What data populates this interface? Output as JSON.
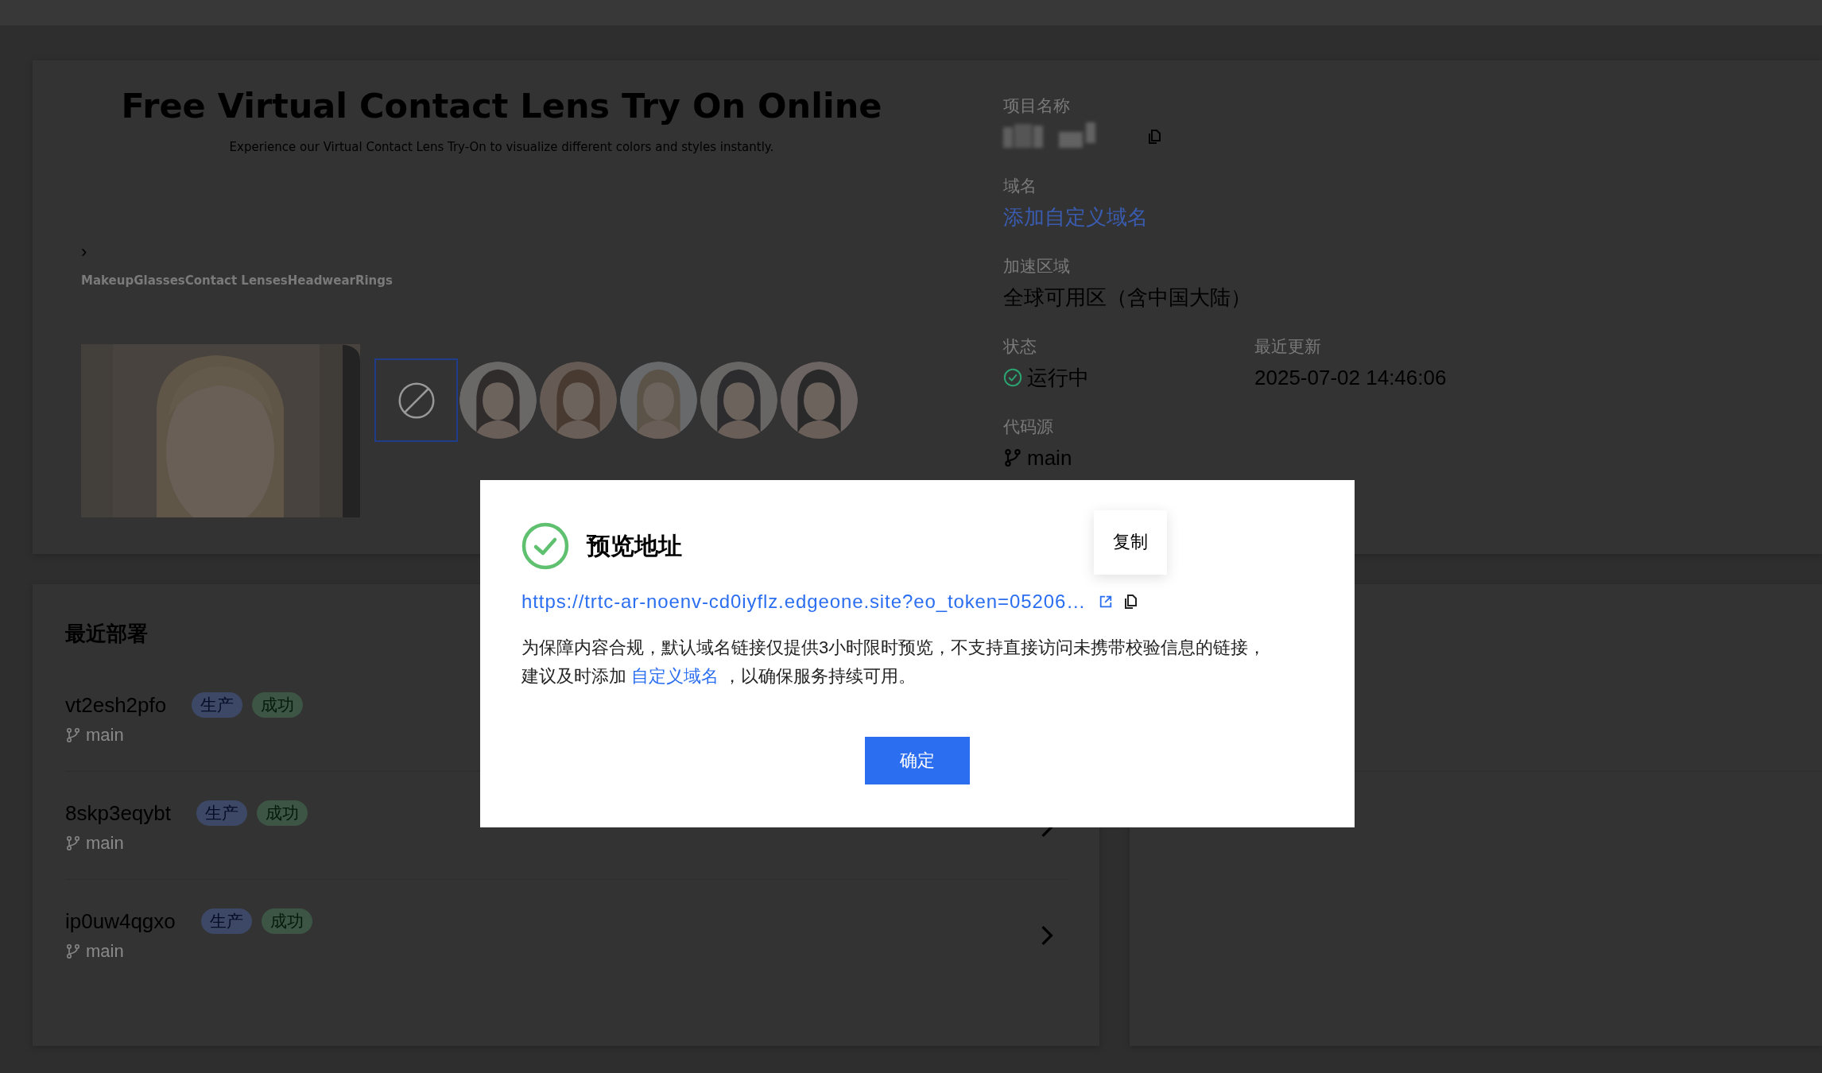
{
  "preview": {
    "title": "Free Virtual Contact Lens Try On Online",
    "subtitle": "Experience our Virtual Contact Lens Try-On to visualize different colors and styles instantly.",
    "chevron": "›",
    "tabs": [
      {
        "label": "Makeup"
      },
      {
        "label": "Glasses"
      },
      {
        "label": "Contact Lenses"
      },
      {
        "label": "Headwear"
      },
      {
        "label": "Rings"
      }
    ],
    "thumbnails": [
      {
        "kind": "none",
        "selected": true
      },
      {
        "kind": "avatar",
        "selected": false
      },
      {
        "kind": "avatar",
        "selected": false
      },
      {
        "kind": "avatar",
        "selected": false
      },
      {
        "kind": "avatar",
        "selected": false
      },
      {
        "kind": "avatar",
        "selected": false
      }
    ]
  },
  "info": [
    {
      "kind": "redacted",
      "label": "项目名称"
    },
    {
      "kind": "link",
      "label": "域名",
      "value": "添加自定义域名"
    },
    {
      "kind": "text",
      "label": "加速区域",
      "value": "全球可用区（含中国大陆）"
    },
    {
      "kind": "pair",
      "items": [
        {
          "kind": "status",
          "label": "状态",
          "value": "运行中"
        },
        {
          "kind": "text",
          "label": "最近更新",
          "value": "2025-07-02 14:46:06"
        }
      ]
    },
    {
      "kind": "branch",
      "label": "代码源",
      "value": "main"
    }
  ],
  "deployments": {
    "title": "最近部署",
    "items": [
      {
        "name": "vt2esh2pfo",
        "tags": [
          {
            "kind": "env",
            "text": "生产"
          },
          {
            "kind": "status",
            "text": "成功"
          }
        ],
        "branch": "main"
      },
      {
        "name": "8skp3eqybt",
        "tags": [
          {
            "kind": "env",
            "text": "生产"
          },
          {
            "kind": "status",
            "text": "成功"
          }
        ],
        "branch": "main",
        "chevron": true
      },
      {
        "name": "ip0uw4qgxo",
        "tags": [
          {
            "kind": "env",
            "text": "生产"
          },
          {
            "kind": "status",
            "text": "成功"
          }
        ],
        "branch": "main",
        "chevron": true
      }
    ]
  },
  "modal": {
    "title": "预览地址",
    "url": "https://trtc-ar-noenv-cd0iyflz.edgeone.site?eo_token=05206…",
    "tooltip": "复制",
    "notice": {
      "before": "为保障内容合规，默认域名链接仅提供3小时限时预览，不支持直接访问未携带校验信息的链接，建议及时添加 ",
      "link": "自定义域名",
      "after": " ，以确保服务持续可用。"
    },
    "confirm": "确定"
  }
}
